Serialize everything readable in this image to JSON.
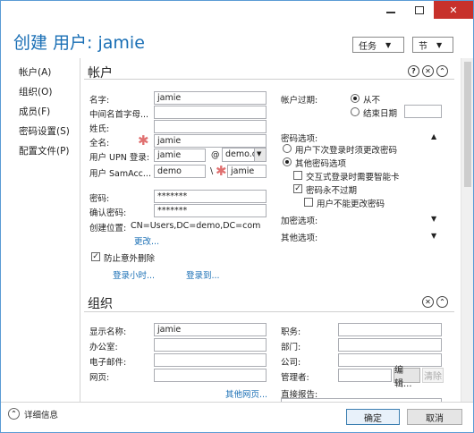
{
  "window": {
    "controls": {
      "minimize": "—",
      "maximize": "□",
      "close": "✕"
    }
  },
  "header": {
    "title": "创建 用户: jamie",
    "tasks_label": "任务",
    "sections_label": "节"
  },
  "nav": {
    "items": [
      "帐户(A)",
      "组织(O)",
      "成员(F)",
      "密码设置(S)",
      "配置文件(P)"
    ]
  },
  "account": {
    "heading": "帐户",
    "fields": {
      "name_label": "名字:",
      "name_value": "jamie",
      "initials_label": "中间名首字母...",
      "initials_value": "",
      "lastname_label": "姓氏:",
      "lastname_value": "",
      "fullname_label": "全名:",
      "fullname_value": "jamie",
      "upn_label": "用户 UPN 登录:",
      "upn_value": "jamie",
      "upn_at": "@",
      "upn_domain": "demo.c",
      "sam_label": "用户 SamAcc...",
      "sam_domain": "demo",
      "sam_sep": "\\",
      "sam_value": "jamie",
      "password_label": "密码:",
      "password_value": "*******",
      "confirm_label": "确认密码:",
      "confirm_value": "*******",
      "location_label": "创建位置:",
      "location_value": "CN=Users,DC=demo,DC=com",
      "change_link": "更改..."
    },
    "protect_label": "防止意外删除",
    "logon_hours_link": "登录小时...",
    "logon_to_link": "登录到...",
    "expiry": {
      "label": "帐户过期:",
      "never": "从不",
      "end_date": "结束日期",
      "end_date_value": ""
    },
    "password_options": {
      "label": "密码选项:",
      "option_change_next": "用户下次登录时须更改密码",
      "option_other": "其他密码选项",
      "smartcard": "交互式登录时需要智能卡",
      "never_expires": "密码永不过期",
      "cannot_change": "用户不能更改密码"
    },
    "encryption_label": "加密选项:",
    "other_label": "其他选项:"
  },
  "org": {
    "heading": "组织",
    "display_name_label": "显示名称:",
    "display_name_value": "jamie",
    "office_label": "办公室:",
    "office_value": "",
    "email_label": "电子邮件:",
    "email_value": "",
    "web_label": "网页:",
    "web_value": "",
    "other_web_link": "其他网页...",
    "job_label": "职务:",
    "job_value": "",
    "dept_label": "部门:",
    "dept_value": "",
    "company_label": "公司:",
    "company_value": "",
    "manager_label": "管理者:",
    "manager_value": "",
    "edit_button": "编辑...",
    "clear_button": "清除",
    "reports_label": "直接报告:"
  },
  "footer": {
    "details": "详细信息",
    "ok": "确定",
    "cancel": "取消"
  }
}
